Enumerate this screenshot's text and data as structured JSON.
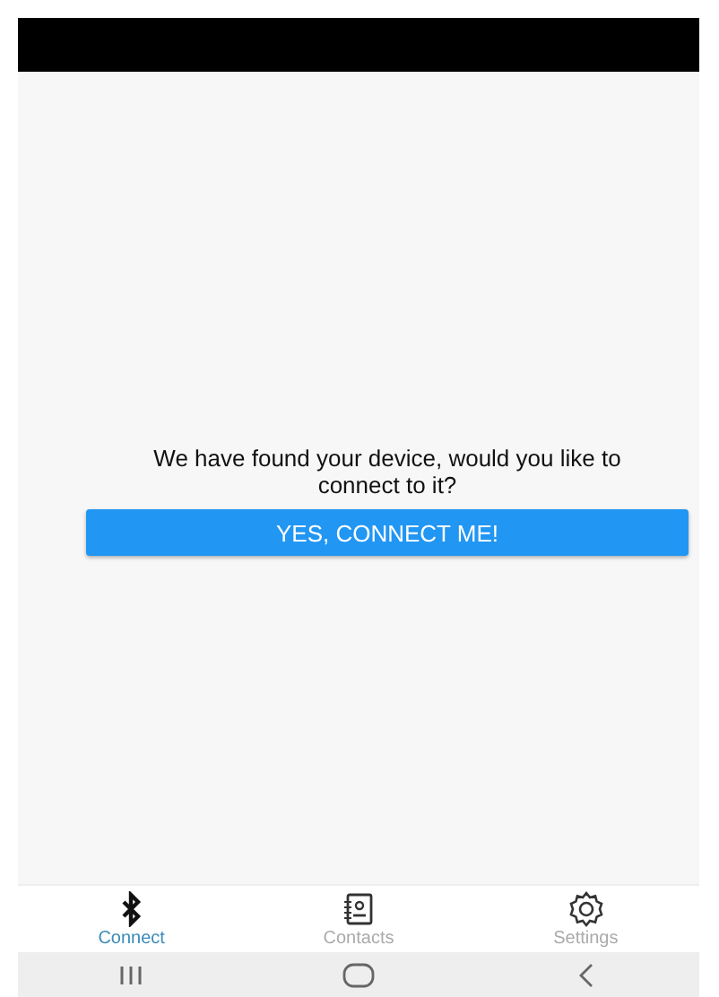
{
  "prompt": {
    "message": "We have found your device, would you like to connect to it?",
    "button": "YES, CONNECT ME!"
  },
  "tabs": [
    {
      "label": "Connect",
      "kind": "bluetooth",
      "selected": true
    },
    {
      "label": "Contacts",
      "kind": "contacts",
      "selected": false
    },
    {
      "label": "Settings",
      "kind": "settings",
      "selected": false
    }
  ],
  "nav_bar": [
    {
      "kind": "recents"
    },
    {
      "kind": "home"
    },
    {
      "kind": "back"
    }
  ]
}
